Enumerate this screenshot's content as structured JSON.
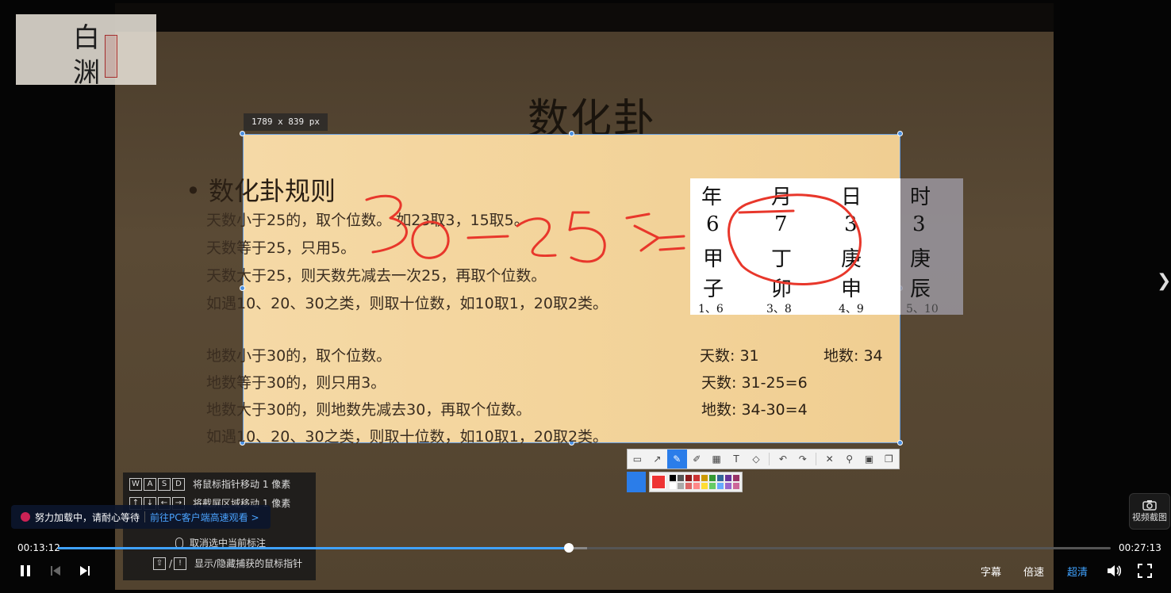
{
  "slide": {
    "title": "数化卦",
    "selection_size": "1789 x 839 px",
    "rules_heading": "数化卦规则",
    "rules": [
      "天数小于25的，取个位数。 如23取3，15取5。",
      "天数等于25，只用5。",
      "天数大于25，则天数先减去一次25，再取个位数。",
      "如遇10、20、30之类，则取十位数，如10取1，20取2类。",
      "地数小于30的，取个位数。",
      "地数等于30的，则只用3。",
      "地数大于30的，则地数先减去30，再取个位数。",
      "如遇10、20、30之类，则取十位数，如10取1，20取2类。"
    ],
    "table": {
      "headers": [
        "年",
        "月",
        "日",
        "时"
      ],
      "numbers": [
        "6",
        "7",
        "3",
        "3"
      ],
      "stems": [
        "甲",
        "丁",
        "庚",
        "庚"
      ],
      "branches": [
        "子",
        "卯",
        "申",
        "辰"
      ],
      "pairs": [
        "1、6",
        "3、8",
        "4、9",
        "5、10"
      ]
    },
    "calc": {
      "tian_label": "天数: 31",
      "di_label": "地数: 34",
      "tian_calc": "天数: 31-25=6",
      "di_calc": "地数: 34-30=4"
    },
    "handwriting": "30-25=5"
  },
  "logo": {
    "char1": "白",
    "char2": "渊"
  },
  "hints": [
    {
      "keys": [
        "W",
        "A",
        "S",
        "D"
      ],
      "text": "将鼠标指针移动 1 像素"
    },
    {
      "keys": [
        "↑",
        "↓",
        "←",
        "→"
      ],
      "text": "将截屏区域移动 1 像素"
    },
    {
      "keys": [],
      "text": "取消选中当前标注"
    },
    {
      "keys": [
        "⇧",
        "!"
      ],
      "text": "显示/隐藏捕获的鼠标指针"
    }
  ],
  "toast": {
    "message": "努力加载中，请耐心等待",
    "link": "前往PC客户端高速观看 >"
  },
  "screenshot_label": "视频截图",
  "player": {
    "current_time": "00:13:12",
    "total_time": "00:27:13",
    "progress": 0.485,
    "buffered": 0.503,
    "subtitle_label": "字幕",
    "speed_label": "倍速",
    "quality_label": "超清",
    "accent": "#3fa2ff"
  }
}
